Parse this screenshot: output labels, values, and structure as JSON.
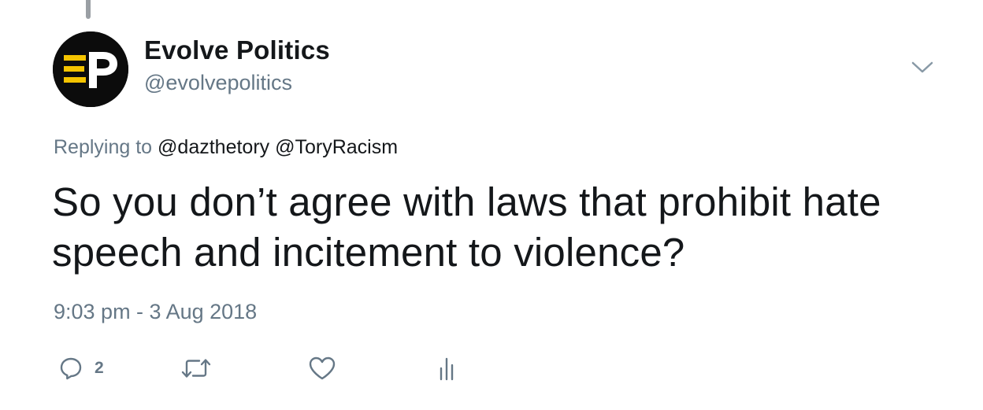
{
  "colors": {
    "text_primary": "#14171a",
    "text_secondary": "#657786",
    "avatar_bg": "#0c0c0c",
    "avatar_stripe": "#f5c400"
  },
  "author": {
    "display_name": "Evolve Politics",
    "handle": "@evolvepolitics",
    "avatar_text": "EP"
  },
  "reply": {
    "prefix": "Replying to",
    "mentions": [
      "@dazthetory",
      "@ToryRacism"
    ]
  },
  "tweet": {
    "text": "So you don’t agree with laws that prohibit hate speech and incitement to violence?",
    "timestamp": "9:03 pm - 3 Aug 2018"
  },
  "actions": {
    "reply_icon": "reply-icon",
    "reply_count": "2",
    "retweet_icon": "retweet-icon",
    "like_icon": "heart-icon",
    "analytics_icon": "analytics-icon",
    "menu_icon": "chevron-down-icon"
  }
}
